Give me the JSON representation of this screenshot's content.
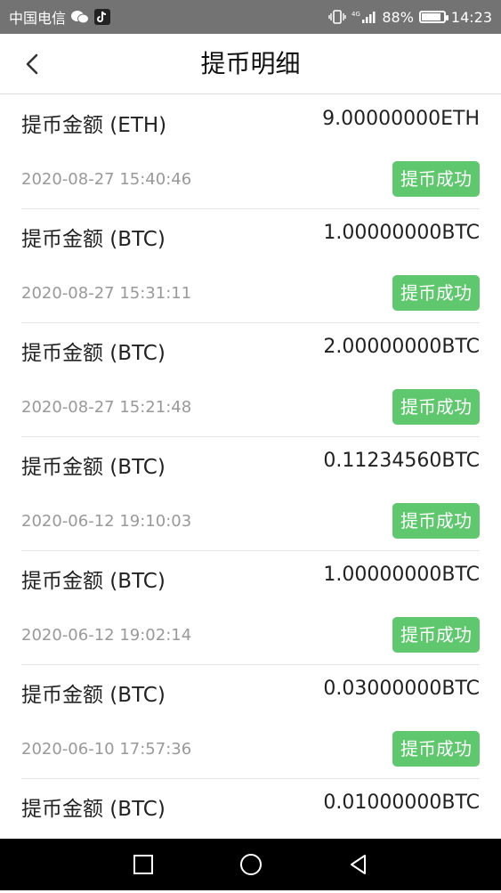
{
  "status_bar": {
    "carrier": "中国电信",
    "network": "4G",
    "battery_percent": "88%",
    "battery_level": 0.88,
    "time": "14:23",
    "icons": [
      "wechat-icon",
      "tiktok-icon",
      "vibrate-icon",
      "signal-icon",
      "battery-icon"
    ]
  },
  "header": {
    "title": "提币明细",
    "back_icon": "chevron-left-icon"
  },
  "records": [
    {
      "label": "提币金额 (ETH)",
      "amount": "9.00000000ETH",
      "time": "2020-08-27 15:40:46",
      "status": "提币成功"
    },
    {
      "label": "提币金额 (BTC)",
      "amount": "1.00000000BTC",
      "time": "2020-08-27 15:31:11",
      "status": "提币成功"
    },
    {
      "label": "提币金额 (BTC)",
      "amount": "2.00000000BTC",
      "time": "2020-08-27 15:21:48",
      "status": "提币成功"
    },
    {
      "label": "提币金额 (BTC)",
      "amount": "0.11234560BTC",
      "time": "2020-06-12 19:10:03",
      "status": "提币成功"
    },
    {
      "label": "提币金额 (BTC)",
      "amount": "1.00000000BTC",
      "time": "2020-06-12 19:02:14",
      "status": "提币成功"
    },
    {
      "label": "提币金额 (BTC)",
      "amount": "0.03000000BTC",
      "time": "2020-06-10 17:57:36",
      "status": "提币成功"
    },
    {
      "label": "提币金额 (BTC)",
      "amount": "0.01000000BTC",
      "time": "",
      "status": ""
    }
  ],
  "colors": {
    "success_badge": "#5fc76e",
    "status_bar": "#737373",
    "time_text": "#999999"
  },
  "system_nav": {
    "icons": [
      "square-icon",
      "circle-icon",
      "triangle-back-icon"
    ]
  }
}
